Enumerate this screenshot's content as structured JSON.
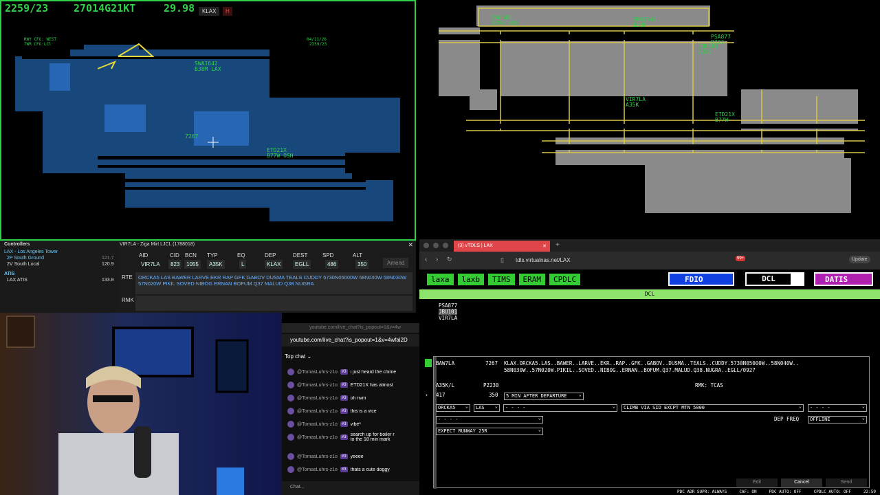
{
  "radar": {
    "time": "2259/23",
    "wind": "27014G21KT",
    "altim": "29.98",
    "airport_btn": "KLAX",
    "h_btn": "H",
    "rwy_cfg": "RWY CFG: WEST",
    "twr_cfg": "TWR CFG:LCl",
    "date": "04/11/26",
    "time_small": "2259/23",
    "targets": [
      {
        "label": "SWA1642\nB38M LAX"
      },
      {
        "label": "7267"
      },
      {
        "label": "ETD21X\nB77W OSH"
      }
    ]
  },
  "airport": {
    "targets": [
      {
        "label": "DAL604\nB764 002"
      },
      {
        "label": "SWA1642\nB38M"
      },
      {
        "label": "PSA877\nB722"
      },
      {
        "label": "JBU101\nA321"
      },
      {
        "label": "VIR7LA\nA35K"
      },
      {
        "label": "ETD21X\nB77W"
      }
    ]
  },
  "controllers": {
    "title": "Controllers",
    "items": [
      {
        "name": "LAX - Los Angeles Tower",
        "freq": ""
      },
      {
        "name": "2P  South Ground",
        "freq": "121.7"
      },
      {
        "name": "2V  South Local",
        "freq": "120.9"
      }
    ],
    "atis_title": "ATIS",
    "atis": [
      {
        "name": "LAX ATIS",
        "freq": "133.8"
      }
    ]
  },
  "flightplan": {
    "title": "VIR7LA - Ziga Mirt LJCL (1788018)",
    "headers": [
      "AID",
      "CID",
      "BCN",
      "TYP",
      "EQ",
      "DEP",
      "DEST",
      "SPD",
      "ALT"
    ],
    "values": [
      "VIR7LA",
      "823",
      "1055",
      "A35K",
      "L",
      "KLAX",
      "EGLL",
      "486",
      "350"
    ],
    "amend": "Amend",
    "rte_label": "RTE",
    "rte": "ORCKA5 LAS BAWER LARVE EKR RAP GFK GABOV DUSMA TEALS CUDDY 5730N05000W 58N040W 58N030W 57N020W PIKIL SOVED NIBOG ERNAN BOFUM Q37 MALUD Q38 NUGRA",
    "rmk_label": "RMK"
  },
  "chat": {
    "url_bar": "youtube.com/live_chat?is_popout=1&v=4w",
    "url": "youtube.com/live_chat?is_popout=1&v=4wfal2D",
    "mode": "Top chat",
    "input_placeholder": "Chat...",
    "messages": [
      {
        "user": "@TomasLuhrs-z1o",
        "badge": "#3",
        "text": "i just heard the chime"
      },
      {
        "user": "@TomasLuhrs-z1o",
        "badge": "#3",
        "text": "ETD21X has almost"
      },
      {
        "user": "@TomasLuhrs-z1o",
        "badge": "#3",
        "text": "oh nvm"
      },
      {
        "user": "@TomasLuhrs-z1o",
        "badge": "#3",
        "text": "this is a vice"
      },
      {
        "user": "@TomasLuhrs-z1o",
        "badge": "#3",
        "text": "vibe*"
      },
      {
        "user": "@TomasLuhrs-z1o",
        "badge": "#3",
        "text": "search up for boiler r to the 18 min mark"
      },
      {
        "user": "@TomasLuhrs-z1o",
        "badge": "#3",
        "text": "yeeee"
      },
      {
        "user": "@TomasLuhrs-z1o",
        "badge": "#3",
        "text": "thats a cute doggy"
      }
    ]
  },
  "browser": {
    "tab": "(3) vTDLS | LAX",
    "url": "tdls.virtualnas.net/LAX",
    "update": "Update",
    "badge": "99+",
    "nav": [
      "laxa",
      "laxb",
      "TIMS",
      "ERAM",
      "CPDLC"
    ],
    "mode_btns": [
      "FDIO",
      "DCL",
      "DATIS"
    ],
    "bar_title": "DCL",
    "list": [
      "PSA877",
      "JBU101",
      "VIR7LA"
    ],
    "card": {
      "cs": "BAW7LA",
      "bcn": "7267",
      "route": "KLAX.ORCKA5.LAS..BAWER..LARVE..EKR..RAP..GFK..GABOV..DUSMA..TEALS..CUDDY.5730N05000W..58N040W..\n58N030W..57N020W.PIKIL..SOVED..NIBOG..ERNAN..BOFUM.Q37.MALUD.Q38.NUGRA..EGLL/0927",
      "type": "A35K/L",
      "ptime": "P2230",
      "rmk": "RMK: TCAS",
      "spd": "417",
      "alt": "350",
      "sel_after": "5 MIN AFTER DEPARTURE",
      "sel_sid": "ORCKA5",
      "sel_trans": "LAS",
      "sel_blank1": "- - - -",
      "sel_climb": "CLIMB VIA SID EXCPT MTN 5000",
      "sel_blank2": "- - - -",
      "sel_blank3": "- - - -",
      "dep_freq_label": "DEP FREQ",
      "sel_freq": "OFFLINE",
      "sel_expect": "EXPECT RUNWAY 25R",
      "edit": "Edit",
      "cancel": "Cancel",
      "send": "Send"
    },
    "status": "PDC ADR SUPR: ALWAYS     CAF: ON     PDC AUTO: OFF     CPDLC AUTO: OFF     22:59"
  }
}
